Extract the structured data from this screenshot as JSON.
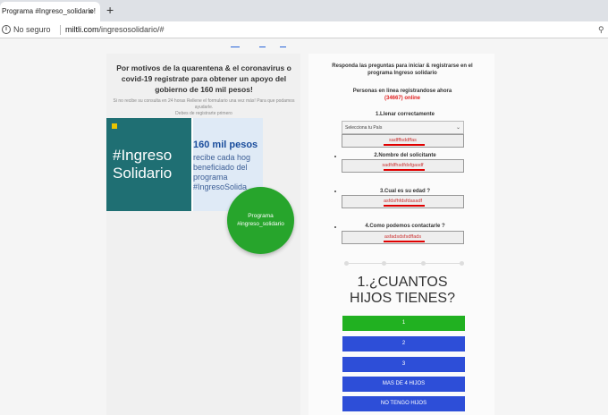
{
  "browser": {
    "tab_title": "Programa #Ingreso_solidario!",
    "tab_close": "×",
    "new_tab": "+",
    "security_label": "No seguro",
    "url_domain": "miltli.com",
    "url_path": "/ingresosolidario/#"
  },
  "left": {
    "heading": "Por motivos de la quarentena & el coronavirus o covid-19 registrate para obtener un apoyo del gobierno de 160 mil pesos!",
    "subtext": "Si no recibe su consulta en 24 horas Rellene el formulario una vez más! Para que podamos ayudarle.",
    "subtext2": "Debes de registrarte primero",
    "banner": {
      "hashtag_line1": "#Ingreso",
      "hashtag_line2": "Solidario",
      "title": "160 mil pesos",
      "line1": "recibe cada hog",
      "line2": "beneficiado del",
      "line3": "programa",
      "line4": "#IngresoSolida"
    },
    "circle_line1": "Programa",
    "circle_line2": "#ingreso_solidario"
  },
  "right": {
    "heading": "Responda las preguntas para iniciar & registrarse en el programa Ingreso solidario",
    "online_prefix": "Personas en linea registrandose ahora",
    "online_count": "(34667)",
    "online_suffix": "online",
    "q1": "1.Llenar correctamente",
    "select_value": "Selecciona tu País",
    "field1": "sadfffsddffas",
    "q2": "2.Nombre del solicitante",
    "field2": "sadfdfhsdfdsfgasdf",
    "q3": "3.Cual es su edad ?",
    "field3": "asfdsfhfdsfdasadf",
    "q4": "4.Como podemos contactarle ?",
    "field4": "asfadsdsfsdffads",
    "big_question_line1": "1.¿CUANTOS",
    "big_question_line2": "HIJOS TIENES?",
    "answers": [
      "1",
      "2",
      "3",
      "MAS DE 4 HIJOS",
      "NO TENGO HIJOS"
    ]
  },
  "colors": {
    "green": "#21b121",
    "blue": "#2d4ed8",
    "red": "#e00000",
    "teal": "#1f6f73"
  }
}
